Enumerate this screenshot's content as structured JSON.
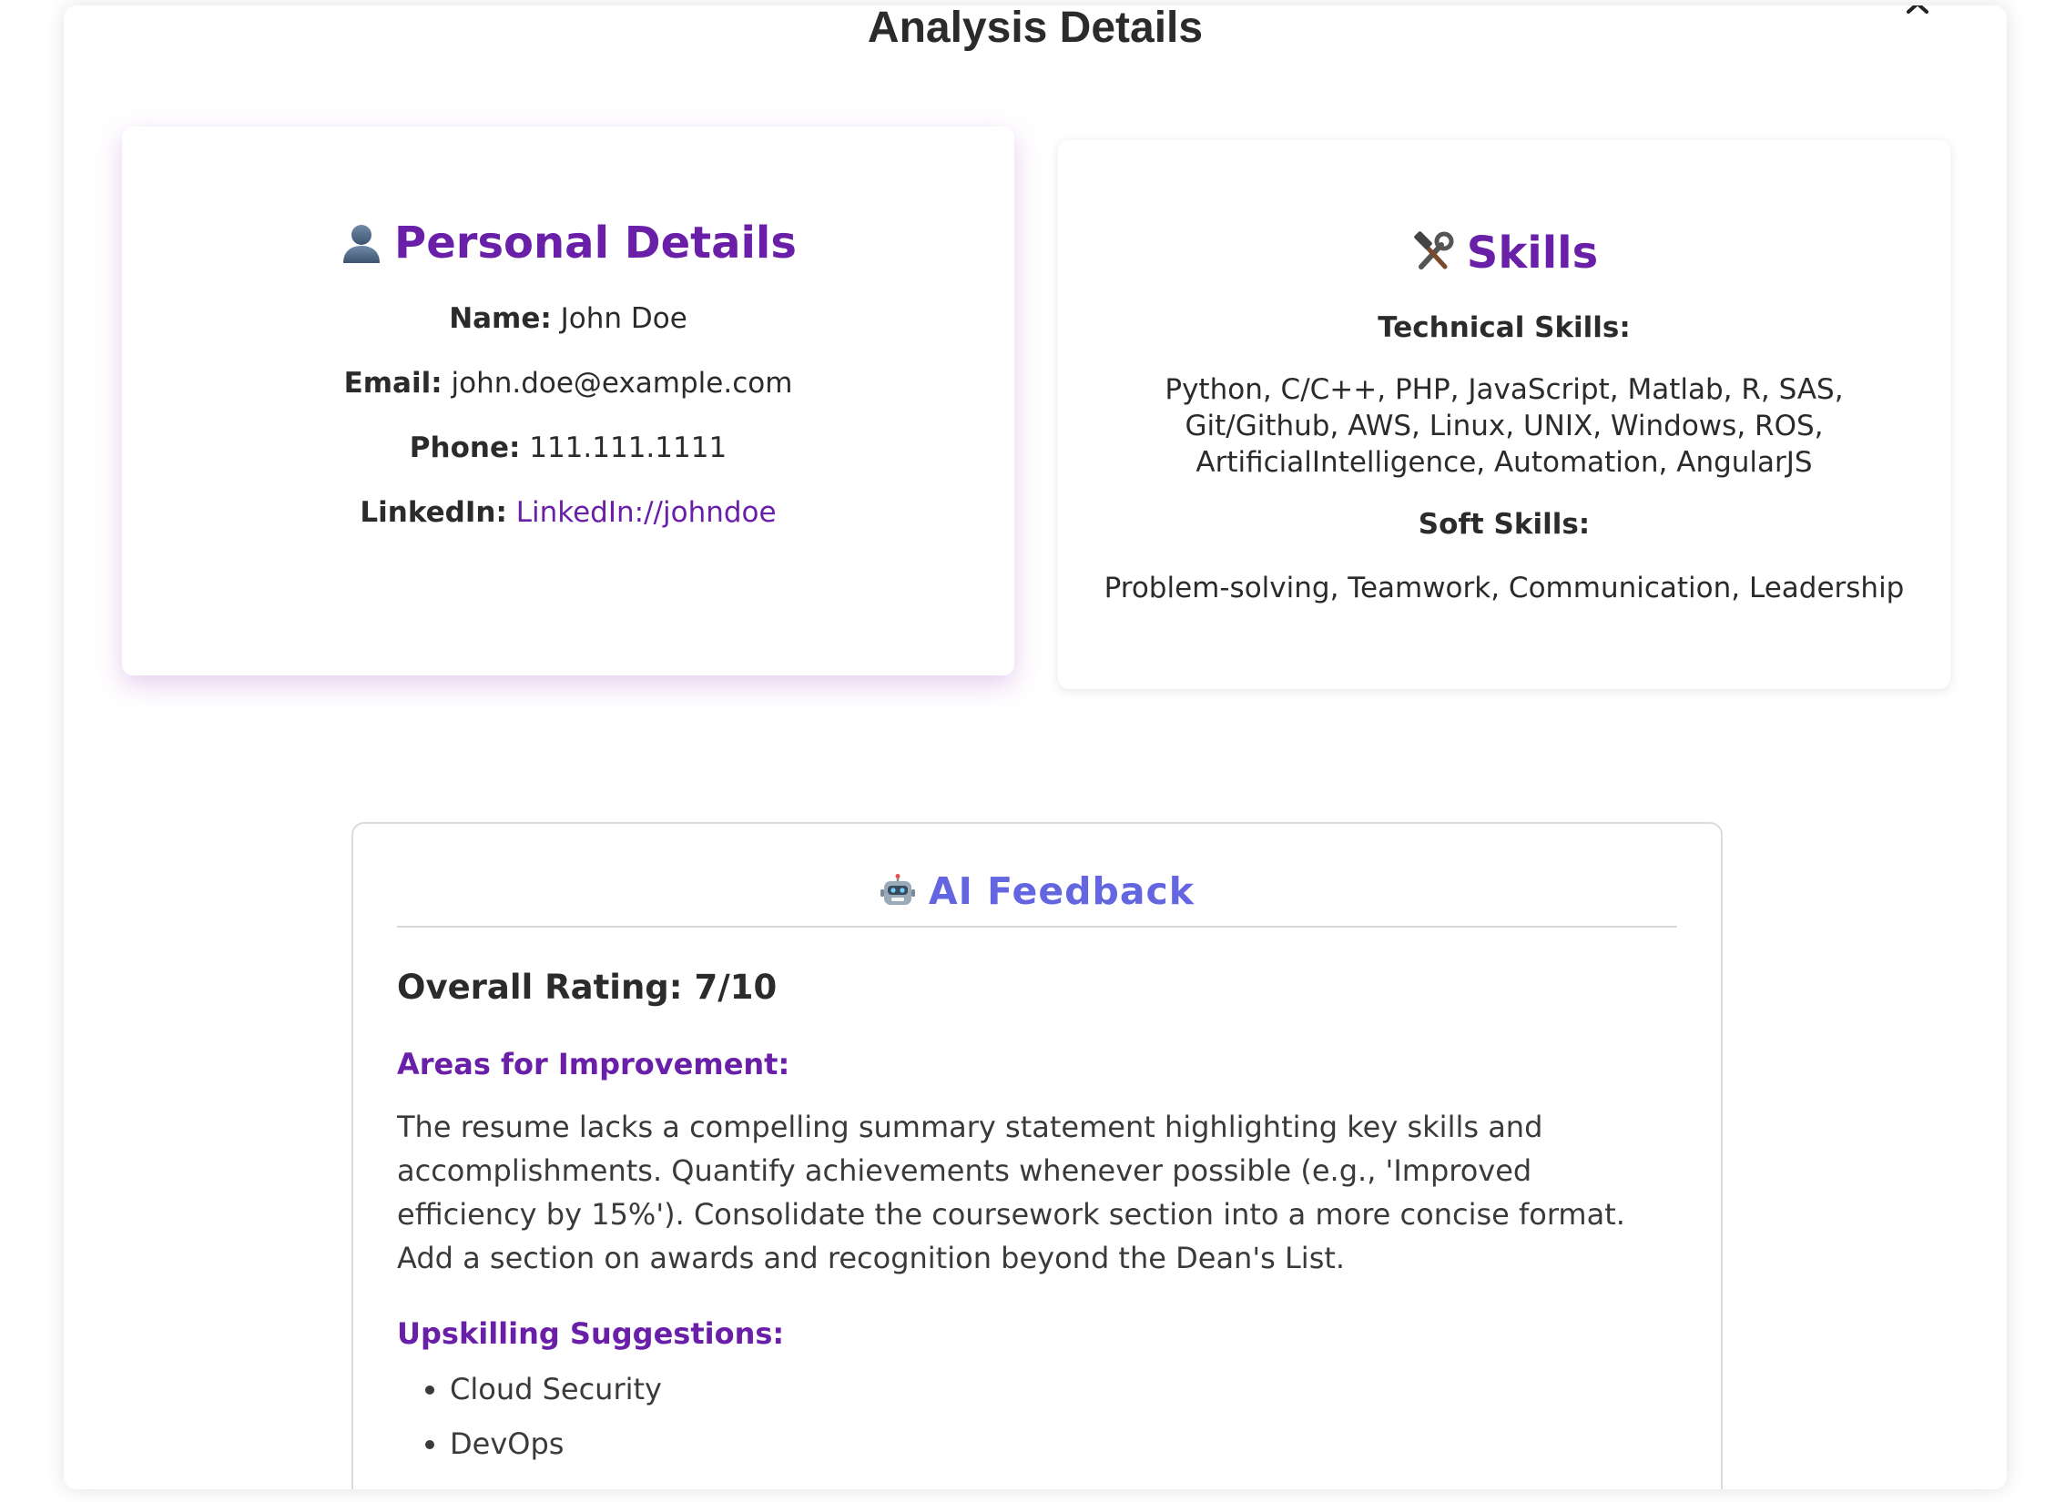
{
  "modal": {
    "title": "Analysis Details",
    "close_icon": "chevron-up-icon"
  },
  "personal": {
    "icon": "person-silhouette-icon",
    "heading": "Personal Details",
    "name_label": "Name:",
    "name_value": "John Doe",
    "email_label": "Email:",
    "email_value": "john.doe@example.com",
    "phone_label": "Phone:",
    "phone_value": "111.111.1111",
    "linkedin_label": "LinkedIn:",
    "linkedin_value": "LinkedIn://johndoe"
  },
  "skills": {
    "icon": "hammer-and-wrench-icon",
    "heading": "Skills",
    "technical_label": "Technical Skills:",
    "technical_value": "Python, C/C++, PHP, JavaScript, Matlab, R, SAS, Git/Github, AWS, Linux, UNIX, Windows, ROS, ArtificialIntelligence, Automation, AngularJS",
    "soft_label": "Soft Skills:",
    "soft_value": "Problem-solving, Teamwork, Communication, Leadership"
  },
  "feedback": {
    "icon": "robot-icon",
    "heading": "AI Feedback",
    "rating": "Overall Rating: 7/10",
    "improvement_title": "Areas for Improvement:",
    "improvement_text": "The resume lacks a compelling summary statement highlighting key skills and accomplishments. Quantify achievements whenever possible (e.g., 'Improved efficiency by 15%'). Consolidate the coursework section into a more concise format. Add a section on awards and recognition beyond the Dean's List.",
    "upskilling_title": "Upskilling Suggestions:",
    "upskilling_items": [
      "Cloud Security",
      "DevOps"
    ]
  },
  "colors": {
    "accent_purple": "#6a1fa8",
    "feedback_indigo": "#6366e0",
    "text_dark": "#2b2b2b"
  }
}
